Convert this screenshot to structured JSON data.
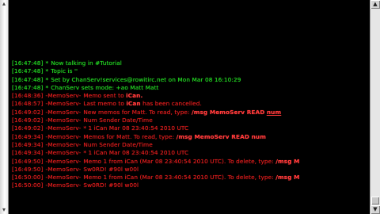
{
  "colors": {
    "background": "#000000",
    "status_green": "#22d022",
    "server_red": "#d81c1c",
    "bright_red": "#ff3a3a"
  },
  "left_panel": {
    "up_icon": "arrow-up-icon",
    "down_icon": "arrow-down-icon"
  },
  "scrollbar": {
    "up_icon": "arrow-up-icon",
    "down_icon": "arrow-down-icon"
  },
  "lines": [
    {
      "ts": "[16:47:48]",
      "sender": "*",
      "text": "Now talking in #Tutorial",
      "color": "#22d022"
    },
    {
      "ts": "[16:47:48]",
      "sender": "*",
      "text": "Topic is ''",
      "color": "#22d022"
    },
    {
      "ts": "[16:47:48]",
      "sender": "*",
      "text": "Set by ChanServ!services@rowitirc.net on Mon Mar 08 16:10:29",
      "color": "#22d022"
    },
    {
      "ts": "[16:47:48]",
      "sender": "*",
      "text": "ChanServ sets mode: +ao Matt Matt",
      "color": "#22d022"
    },
    {
      "ts": "[16:48:36]",
      "sender": "-MemoServ-",
      "text": "Memo sent to",
      "highlight": "iCan.",
      "color": "#d81c1c"
    },
    {
      "ts": "[16:48:57]",
      "sender": "-MemoServ-",
      "text": "Last memo to",
      "highlight": "iCan",
      "after": "has been cancelled.",
      "color": "#d81c1c"
    },
    {
      "ts": "[16:49:02]",
      "sender": "-MemoServ-",
      "text": "New memos for Matt.    To read, type:",
      "highlight": "/msg MemoServ READ",
      "underline": "num",
      "color": "#d81c1c"
    },
    {
      "ts": "[16:49:02]",
      "sender": "-MemoServ-",
      "text": "Num  Sender             Date/Time",
      "color": "#d81c1c"
    },
    {
      "ts": "[16:49:02]",
      "sender": "-MemoServ-",
      "text": "*  1  iCan               Mar 08 23:40:54 2010 UTC",
      "color": "#d81c1c"
    },
    {
      "ts": "[16:49:34]",
      "sender": "-MemoServ-",
      "text": "Memos for Matt.   To read, type:",
      "highlight": "/msg MemoServ READ num",
      "color": "#d81c1c"
    },
    {
      "ts": "[16:49:34]",
      "sender": "-MemoServ-",
      "text": "Num  Sender             Date/Time",
      "color": "#d81c1c"
    },
    {
      "ts": "[16:49:34]",
      "sender": "-MemoServ-",
      "text": "*  1  iCan               Mar 08 23:40:54 2010 UTC",
      "color": "#d81c1c"
    },
    {
      "ts": "[16:49:50]",
      "sender": "-MemoServ-",
      "text": "Memo 1 from iCan (Mar 08 23:40:54 2010 UTC).   To delete, type:",
      "highlight": "/msg M",
      "color": "#d81c1c"
    },
    {
      "ts": "[16:49:50]",
      "sender": "-MemoServ-",
      "text": "Sw0RD! #90l w00l",
      "color": "#d81c1c"
    },
    {
      "ts": "[16:50:00]",
      "sender": "-MemoServ-",
      "text": "Memo 1 from iCan (Mar 08 23:40:54 2010 UTC).   To delete, type:",
      "highlight": "/msg M",
      "color": "#d81c1c"
    },
    {
      "ts": "[16:50:00]",
      "sender": "-MemoServ-",
      "text": "Sw0RD! #90l w00l",
      "color": "#d81c1c"
    }
  ]
}
